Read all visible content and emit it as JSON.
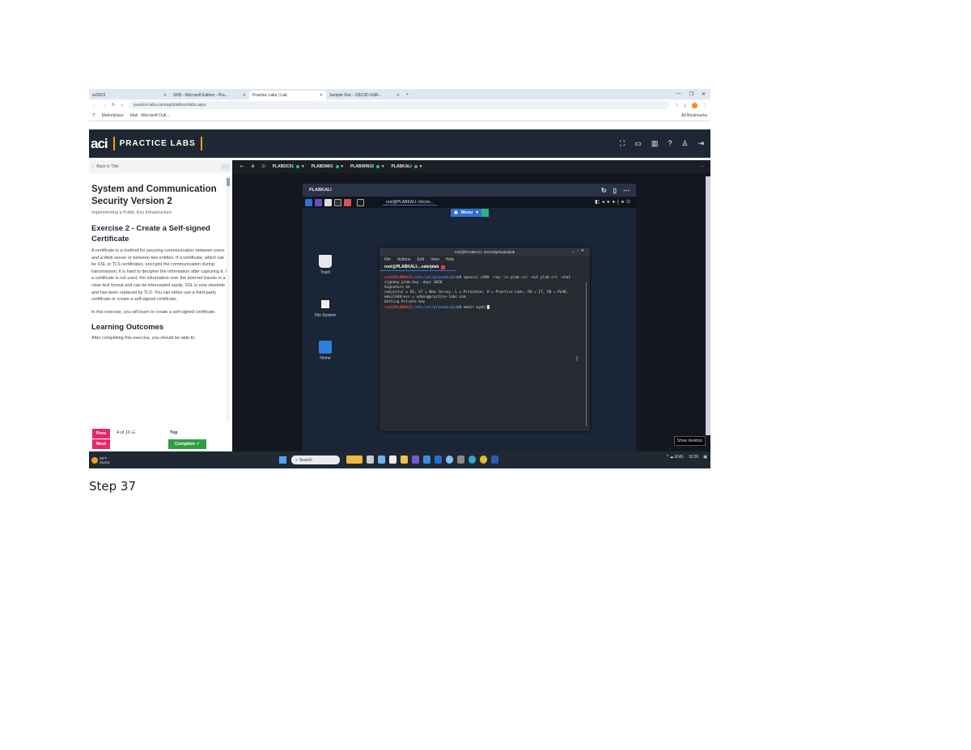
{
  "browser": {
    "tabs": [
      {
        "label": "w/2023",
        "active": false
      },
      {
        "label": "SKB - Microsoft Edition - Pra...",
        "active": false
      },
      {
        "label": "Practice Labs | Lab",
        "active": true
      },
      {
        "label": "Sample Doc - CBC2D-SSR...",
        "active": false
      }
    ],
    "new_tab": "+",
    "url": "practice-labs.com/api/platform/labs.aspx",
    "bookmarks": [
      "Marketplace",
      "Mail - Microsoft Outl..."
    ],
    "all_bookmarks": "All Bookmarks"
  },
  "app": {
    "logo": "aci",
    "brand": "PRACTICE LABS",
    "back": "← Back to Title",
    "more": "···",
    "title": "System and Communication Security Version 2",
    "subtitle": "Implementing a Public Key Infrastructure",
    "exercise_title": "Exercise 2 - Create a Self-signed Certificate",
    "para1": "A certificate is a method for securing communication between users and a Web server or between two entities. If a certificate, which can be SSL or TLS certificates, encrypts the communication during transmission, it is hard to decipher the information after capturing it. If a certificate is not used, the information over the Internet travels in a clear-text format and can be intercepted easily. SSL is now obsolete and has been replaced by TLS. You can either use a third-party certificate or create a self-signed certificate.",
    "para2": "In this exercise, you will learn to create a self-signed certificate.",
    "outcomes_title": "Learning Outcomes",
    "outcomes_text": "After completing this exercise, you should be able to:",
    "prev": "Prev",
    "next": "Next",
    "page_of": "4 of 10 ☷",
    "top": "Top",
    "complete": "Complete ✓"
  },
  "vms": [
    "PLABDC01",
    "PLABDM01",
    "PLABWIN10",
    "PLABKALI"
  ],
  "kali": {
    "window_title": "PLABKALI",
    "task_label": "root@PLABKALI: /etc/ss...",
    "menu_label": "Menu",
    "desktop_icons": [
      "Trash",
      "File System",
      "Home"
    ]
  },
  "terminal": {
    "title": "root@PLABKALI: /etc/ssl/private/plab",
    "menu": [
      "File",
      "Actions",
      "Edit",
      "View",
      "Help"
    ],
    "tab": "root@PLABKALI:...vate/plab",
    "prompt_user": "root@PLABKALI",
    "prompt_path": ":/etc/ssl/private/plab",
    "cmd1": "# openssl x509 -req -in plab.csr -out plab.crt -sha1 -signkey plab.key -days 3650",
    "out1": "Signature ok",
    "out2": "subject=C = US, ST = New Jersey, L = Princeton, O = Practice Labs, OU = IT, CN = PLAB, emailAddress = admin@practice-labs.com",
    "out3": "Getting Private key",
    "cmd2": "# mkdir mydir"
  },
  "show_desktop": "Show desktop",
  "taskbar": {
    "weather_temp": "68°F",
    "weather_desc": "Sunny",
    "search": "Search",
    "tray": "^  ☁  ENG",
    "time": "10:30"
  },
  "caption": "Step 37",
  "colors": {
    "accent": "#f4a300",
    "prev_next": "#e5286b",
    "complete": "#2e9e3e",
    "vm_status": "#36c05a"
  }
}
